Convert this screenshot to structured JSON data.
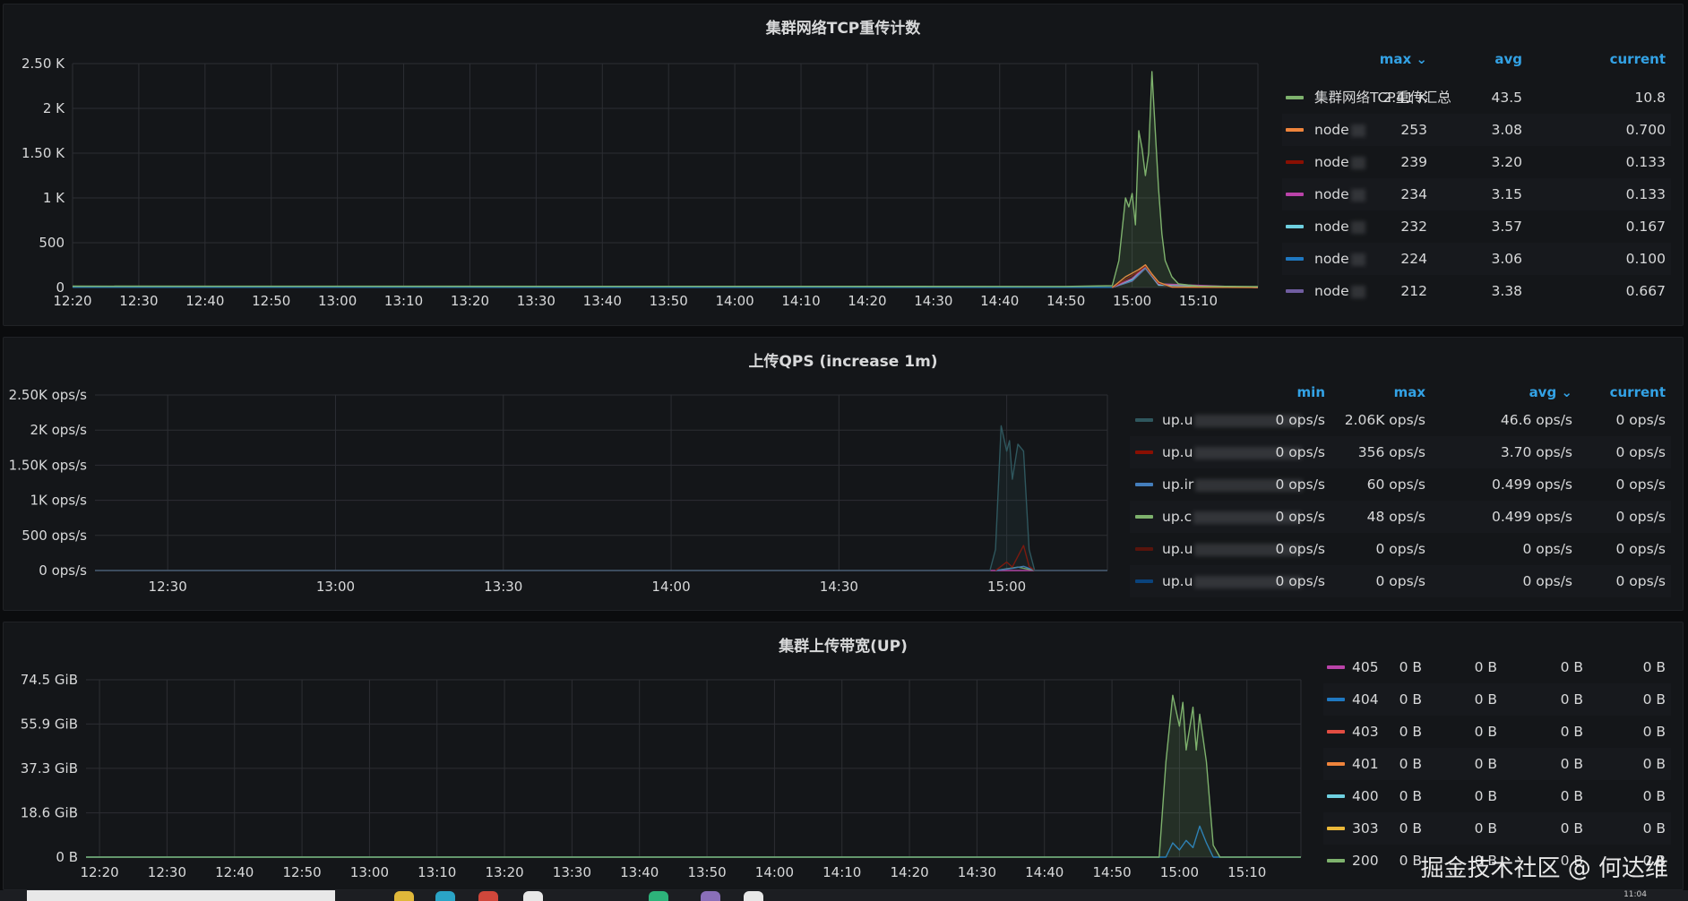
{
  "panels": [
    {
      "title": "集群网络TCP重传计数",
      "legend": {
        "columns": [
          {
            "label": "max",
            "sort": true
          },
          {
            "label": "avg",
            "sort": false
          },
          {
            "label": "current",
            "sort": false
          }
        ],
        "rows": [
          {
            "name": "集群网络TCP重传汇总",
            "color": "#7eb26d",
            "values": [
              "2.41 K",
              "43.5",
              "10.8"
            ]
          },
          {
            "name": "node",
            "color": "#ef843c",
            "values": [
              "253",
              "3.08",
              "0.700"
            ]
          },
          {
            "name": "node",
            "color": "#890f02",
            "values": [
              "239",
              "3.20",
              "0.133"
            ]
          },
          {
            "name": "node",
            "color": "#ba43a9",
            "values": [
              "234",
              "3.15",
              "0.133"
            ]
          },
          {
            "name": "node",
            "color": "#6ed0e0",
            "values": [
              "232",
              "3.57",
              "0.167"
            ]
          },
          {
            "name": "node",
            "color": "#1f78c1",
            "values": [
              "224",
              "3.06",
              "0.100"
            ]
          },
          {
            "name": "node",
            "color": "#705da0",
            "values": [
              "212",
              "3.38",
              "0.667"
            ]
          }
        ]
      }
    },
    {
      "title": "上传QPS (increase 1m)",
      "legend": {
        "columns": [
          {
            "label": "min",
            "sort": false
          },
          {
            "label": "max",
            "sort": false
          },
          {
            "label": "avg",
            "sort": true
          },
          {
            "label": "current",
            "sort": false
          }
        ],
        "rows": [
          {
            "name": "up.u",
            "color": "#2f575e",
            "values": [
              "0 ops/s",
              "2.06K ops/s",
              "46.6 ops/s",
              "0 ops/s"
            ]
          },
          {
            "name": "up.u",
            "color": "#890f02",
            "values": [
              "0 ops/s",
              "356 ops/s",
              "3.70 ops/s",
              "0 ops/s"
            ]
          },
          {
            "name": "up.ir",
            "color": "#447ebc",
            "values": [
              "0 ops/s",
              "60 ops/s",
              "0.499 ops/s",
              "0 ops/s"
            ]
          },
          {
            "name": "up.c",
            "color": "#7eb26d",
            "values": [
              "0 ops/s",
              "48 ops/s",
              "0.499 ops/s",
              "0 ops/s"
            ]
          },
          {
            "name": "up.u",
            "color": "#58140c",
            "values": [
              "0 ops/s",
              "0 ops/s",
              "0 ops/s",
              "0 ops/s"
            ]
          },
          {
            "name": "up.u",
            "color": "#0a437c",
            "values": [
              "0 ops/s",
              "0 ops/s",
              "0 ops/s",
              "0 ops/s"
            ]
          }
        ]
      }
    },
    {
      "title": "集群上传带宽(UP)",
      "legend": {
        "rows": [
          {
            "name": "405",
            "color": "#ba43a9",
            "values": [
              "0 B",
              "0 B",
              "0 B",
              "0 B"
            ]
          },
          {
            "name": "404",
            "color": "#1f78c1",
            "values": [
              "0 B",
              "0 B",
              "0 B",
              "0 B"
            ]
          },
          {
            "name": "403",
            "color": "#e24d42",
            "values": [
              "0 B",
              "0 B",
              "0 B",
              "0 B"
            ]
          },
          {
            "name": "401",
            "color": "#ef843c",
            "values": [
              "0 B",
              "0 B",
              "0 B",
              "0 B"
            ]
          },
          {
            "name": "400",
            "color": "#6ed0e0",
            "values": [
              "0 B",
              "0 B",
              "0 B",
              "0 B"
            ]
          },
          {
            "name": "303",
            "color": "#eab839",
            "values": [
              "0 B",
              "0 B",
              "0 B",
              "0 B"
            ]
          },
          {
            "name": "200",
            "color": "#7eb26d",
            "values": [
              "0 B",
              "0 B",
              "0 B",
              "0 B"
            ]
          }
        ]
      }
    }
  ],
  "chart_data": [
    {
      "type": "line",
      "title": "集群网络TCP重传计数",
      "y_tick_labels": [
        "0",
        "500",
        "1 K",
        "1.50 K",
        "2 K",
        "2.50 K"
      ],
      "y_ticks": [
        0,
        500,
        1000,
        1500,
        2000,
        2500
      ],
      "ylim": [
        0,
        2500
      ],
      "x_tick_labels": [
        "12:20",
        "12:30",
        "12:40",
        "12:50",
        "13:00",
        "13:10",
        "13:20",
        "13:30",
        "13:40",
        "13:50",
        "14:00",
        "14:10",
        "14:20",
        "14:30",
        "14:40",
        "14:50",
        "15:00",
        "15:10"
      ],
      "x_ticks": [
        "12:20",
        "12:30",
        "12:40",
        "12:50",
        "13:00",
        "13:10",
        "13:20",
        "13:30",
        "13:40",
        "13:50",
        "14:00",
        "14:10",
        "14:20",
        "14:30",
        "14:40",
        "14:50",
        "15:00",
        "15:10"
      ],
      "xlim": [
        "12:20",
        "15:19"
      ],
      "grid": true,
      "legend_position": "right",
      "series": [
        {
          "name": "集群网络TCP重传汇总",
          "color": "#7eb26d",
          "fill": true,
          "points": [
            [
              "12:20",
              15
            ],
            [
              "14:50",
              12
            ],
            [
              "14:57",
              20
            ],
            [
              "14:58",
              300
            ],
            [
              "14:59",
              1000
            ],
            [
              "14:59:30",
              900
            ],
            [
              "15:00",
              1050
            ],
            [
              "15:00:30",
              700
            ],
            [
              "15:01",
              1750
            ],
            [
              "15:01:30",
              1550
            ],
            [
              "15:02",
              1250
            ],
            [
              "15:02:30",
              1500
            ],
            [
              "15:03",
              2410
            ],
            [
              "15:03:30",
              1750
            ],
            [
              "15:04",
              1100
            ],
            [
              "15:04:30",
              600
            ],
            [
              "15:05",
              300
            ],
            [
              "15:06",
              120
            ],
            [
              "15:07",
              40
            ],
            [
              "15:10",
              15
            ],
            [
              "15:19",
              10
            ]
          ]
        },
        {
          "name": "node",
          "color": "#ef843c",
          "points": [
            [
              "14:57",
              0
            ],
            [
              "14:59",
              120
            ],
            [
              "15:01",
              200
            ],
            [
              "15:02",
              253
            ],
            [
              "15:03",
              150
            ],
            [
              "15:04",
              60
            ],
            [
              "15:06",
              5
            ],
            [
              "15:19",
              1
            ]
          ]
        },
        {
          "name": "node",
          "color": "#890f02",
          "points": [
            [
              "14:57",
              0
            ],
            [
              "14:59",
              90
            ],
            [
              "15:01",
              180
            ],
            [
              "15:02",
              239
            ],
            [
              "15:03",
              140
            ],
            [
              "15:04",
              50
            ],
            [
              "15:06",
              4
            ],
            [
              "15:19",
              0
            ]
          ]
        },
        {
          "name": "node",
          "color": "#ba43a9",
          "points": [
            [
              "14:57",
              0
            ],
            [
              "15:00",
              100
            ],
            [
              "15:02",
              234
            ],
            [
              "15:04",
              40
            ],
            [
              "15:19",
              0
            ]
          ]
        },
        {
          "name": "node",
          "color": "#6ed0e0",
          "points": [
            [
              "14:57",
              0
            ],
            [
              "15:00",
              90
            ],
            [
              "15:02",
              232
            ],
            [
              "15:04",
              30
            ],
            [
              "15:19",
              0
            ]
          ]
        },
        {
          "name": "node",
          "color": "#1f78c1",
          "points": [
            [
              "12:20",
              3
            ],
            [
              "14:57",
              2
            ],
            [
              "15:00",
              80
            ],
            [
              "15:02",
              224
            ],
            [
              "15:04",
              30
            ],
            [
              "15:19",
              0
            ]
          ]
        },
        {
          "name": "node",
          "color": "#705da0",
          "points": [
            [
              "14:57",
              0
            ],
            [
              "15:00",
              70
            ],
            [
              "15:02",
              212
            ],
            [
              "15:04",
              25
            ],
            [
              "15:19",
              1
            ]
          ]
        }
      ]
    },
    {
      "type": "line",
      "title": "上传QPS (increase 1m)",
      "y_tick_labels": [
        "0 ops/s",
        "500 ops/s",
        "1K ops/s",
        "1.50K ops/s",
        "2K ops/s",
        "2.50K ops/s"
      ],
      "y_ticks": [
        0,
        500,
        1000,
        1500,
        2000,
        2500
      ],
      "ylim": [
        0,
        2500
      ],
      "x_tick_labels": [
        "12:30",
        "13:00",
        "13:30",
        "14:00",
        "14:30",
        "15:00"
      ],
      "x_ticks": [
        "12:30",
        "13:00",
        "13:30",
        "14:00",
        "14:30",
        "15:00"
      ],
      "xlim": [
        "12:17",
        "15:18"
      ],
      "grid": true,
      "legend_position": "right",
      "series": [
        {
          "name": "up.u",
          "color": "#2f575e",
          "fill": true,
          "points": [
            [
              "12:17",
              0
            ],
            [
              "14:57",
              0
            ],
            [
              "14:58",
              300
            ],
            [
              "14:59",
              2060
            ],
            [
              "15:00",
              1700
            ],
            [
              "15:00:30",
              1850
            ],
            [
              "15:01",
              1300
            ],
            [
              "15:02",
              1800
            ],
            [
              "15:03",
              1700
            ],
            [
              "15:04",
              300
            ],
            [
              "15:05",
              0
            ],
            [
              "15:18",
              0
            ]
          ]
        },
        {
          "name": "up.u",
          "color": "#890f02",
          "points": [
            [
              "14:58",
              0
            ],
            [
              "15:00",
              120
            ],
            [
              "15:01",
              50
            ],
            [
              "15:03",
              356
            ],
            [
              "15:04",
              60
            ],
            [
              "15:05",
              0
            ]
          ]
        },
        {
          "name": "up.ir",
          "color": "#447ebc",
          "points": [
            [
              "14:58",
              0
            ],
            [
              "15:01",
              30
            ],
            [
              "15:03",
              60
            ],
            [
              "15:05",
              0
            ]
          ]
        },
        {
          "name": "up.c",
          "color": "#7eb26d",
          "points": [
            [
              "14:58",
              0
            ],
            [
              "15:02",
              48
            ],
            [
              "15:05",
              0
            ]
          ]
        },
        {
          "name": "up.u",
          "color": "#ba43a9",
          "points": [
            [
              "12:17",
              0
            ],
            [
              "15:18",
              0
            ]
          ]
        }
      ]
    },
    {
      "type": "line",
      "title": "集群上传带宽(UP)",
      "y_tick_labels": [
        "0 B",
        "18.6 GiB",
        "37.3 GiB",
        "55.9 GiB",
        "74.5 GiB"
      ],
      "y_ticks": [
        0,
        18.6,
        37.3,
        55.9,
        74.5
      ],
      "ylim": [
        0,
        74.5
      ],
      "x_tick_labels": [
        "12:20",
        "12:30",
        "12:40",
        "12:50",
        "13:00",
        "13:10",
        "13:20",
        "13:30",
        "13:40",
        "13:50",
        "14:00",
        "14:10",
        "14:20",
        "14:30",
        "14:40",
        "14:50",
        "15:00",
        "15:10"
      ],
      "x_ticks": [
        "12:20",
        "12:30",
        "12:40",
        "12:50",
        "13:00",
        "13:10",
        "13:20",
        "13:30",
        "13:40",
        "13:50",
        "14:00",
        "14:10",
        "14:20",
        "14:30",
        "14:40",
        "14:50",
        "15:00",
        "15:10"
      ],
      "xlim": [
        "12:18",
        "15:18"
      ],
      "grid": true,
      "legend_position": "right",
      "series": [
        {
          "name": "200",
          "color": "#7eb26d",
          "fill": true,
          "points": [
            [
              "12:18",
              0
            ],
            [
              "14:57",
              0
            ],
            [
              "14:58",
              40
            ],
            [
              "14:59",
              68
            ],
            [
              "15:00",
              55
            ],
            [
              "15:00:30",
              65
            ],
            [
              "15:01",
              45
            ],
            [
              "15:02",
              63
            ],
            [
              "15:02:30",
              45
            ],
            [
              "15:03",
              60
            ],
            [
              "15:04",
              40
            ],
            [
              "15:05",
              5
            ],
            [
              "15:06",
              0
            ],
            [
              "15:18",
              0
            ]
          ]
        },
        {
          "name": "404",
          "color": "#1f78c1",
          "points": [
            [
              "12:18",
              0
            ],
            [
              "14:58",
              0
            ],
            [
              "14:59",
              6
            ],
            [
              "15:00",
              3
            ],
            [
              "15:01",
              7
            ],
            [
              "15:02",
              4
            ],
            [
              "15:03",
              13
            ],
            [
              "15:04",
              6
            ],
            [
              "15:05",
              0
            ],
            [
              "15:18",
              0
            ]
          ]
        }
      ]
    }
  ],
  "watermark": "掘金技术社区 @ 何达维",
  "taskbar": {
    "clock": "11:04"
  }
}
